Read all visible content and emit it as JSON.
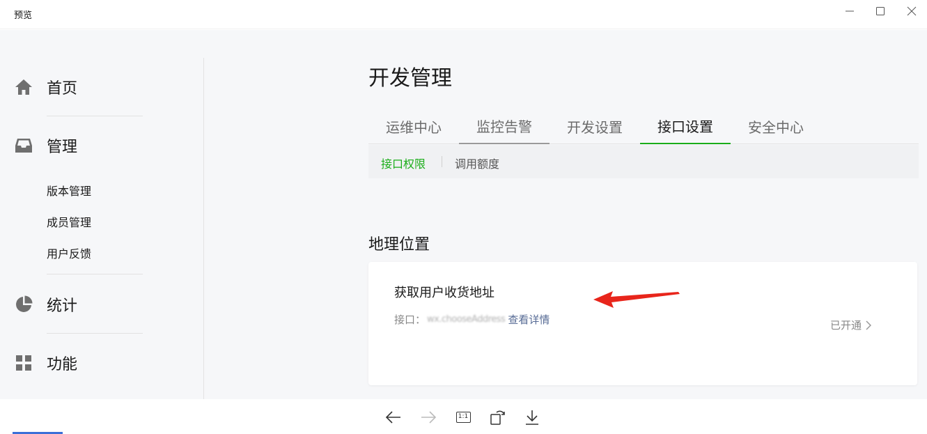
{
  "window": {
    "title": "预览"
  },
  "sidebar": {
    "items": [
      {
        "label": "首页",
        "icon": "home-icon"
      },
      {
        "label": "管理",
        "icon": "inbox-icon"
      },
      {
        "label": "统计",
        "icon": "pie-chart-icon"
      },
      {
        "label": "功能",
        "icon": "grid-icon"
      }
    ],
    "sub_items": [
      "版本管理",
      "成员管理",
      "用户反馈"
    ]
  },
  "main": {
    "page_title": "开发管理",
    "tabs": [
      {
        "label": "运维中心"
      },
      {
        "label": "监控告警"
      },
      {
        "label": "开发设置"
      },
      {
        "label": "接口设置"
      },
      {
        "label": "安全中心"
      }
    ],
    "active_tab": "接口设置",
    "subtabs": [
      {
        "label": "接口权限"
      },
      {
        "label": "调用额度"
      }
    ],
    "section_title": "地理位置",
    "card": {
      "title": "获取用户收货地址",
      "api_prefix": "接口：",
      "api_value": "wx.chooseAddress",
      "detail_link": "查看详情",
      "status": "已开通"
    }
  },
  "colors": {
    "accent_green": "#1aad19",
    "link_blue": "#576b95",
    "annotation_red": "#e8251b"
  }
}
